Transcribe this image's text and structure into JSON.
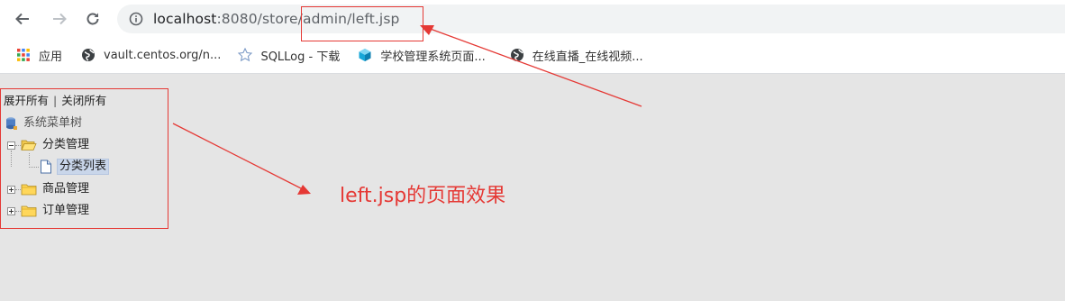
{
  "browser": {
    "url_host": "localhost",
    "url_path": ":8080/store/admin/left.jsp",
    "icons": {
      "back": "arrow-left-icon",
      "forward": "arrow-right-icon",
      "reload": "reload-icon",
      "site_info": "info-icon"
    },
    "bookmarks": [
      {
        "label": "应用",
        "icon": "apps-grid-icon"
      },
      {
        "label": "vault.centos.org/n...",
        "icon": "globe-icon"
      },
      {
        "label": "SQLLog - 下载",
        "icon": "star-icon"
      },
      {
        "label": "学校管理系统页面...",
        "icon": "cube-icon"
      },
      {
        "label": "在线直播_在线视频...",
        "icon": "globe-icon"
      }
    ]
  },
  "tree": {
    "expand_all": "展开所有",
    "separator": "|",
    "collapse_all": "关闭所有",
    "root": "系统菜单树",
    "nodes": [
      {
        "label": "分类管理",
        "expanded": true
      },
      {
        "label": "分类列表",
        "selected": true
      },
      {
        "label": "商品管理",
        "expanded": false
      },
      {
        "label": "订单管理",
        "expanded": false
      }
    ]
  },
  "annotation": {
    "caption": "left.jsp的页面效果",
    "color": "#e53935"
  }
}
